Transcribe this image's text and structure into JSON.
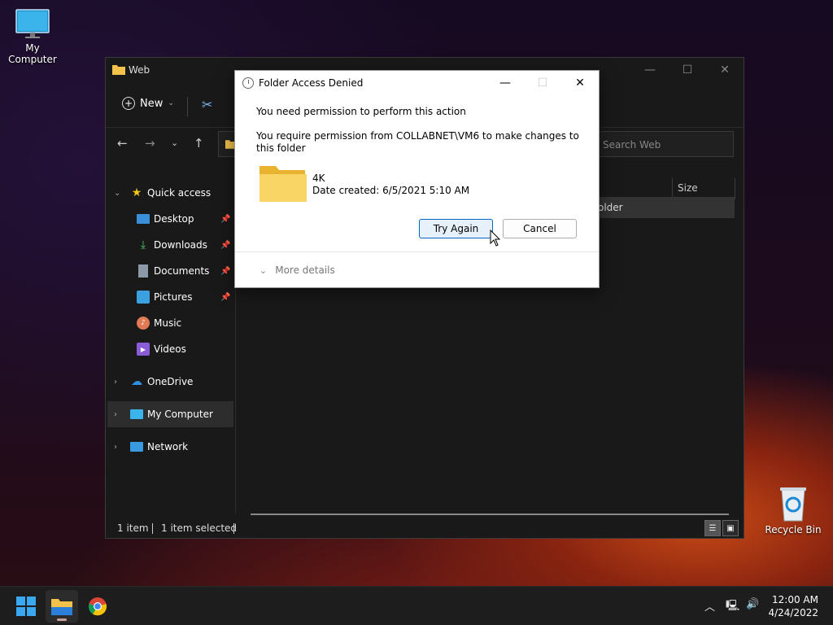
{
  "desktop": {
    "my_computer_label": "My Computer",
    "recycle_bin_label": "Recycle Bin"
  },
  "explorer": {
    "title": "Web",
    "toolbar": {
      "new_label": "New"
    },
    "search_placeholder": "Search Web",
    "column_size": "Size",
    "selected_item_partial": "older",
    "sidebar": {
      "quick_access": "Quick access",
      "items": [
        {
          "label": "Desktop",
          "icon": "desktop-icon",
          "pinned": true
        },
        {
          "label": "Downloads",
          "icon": "downloads-icon",
          "pinned": true
        },
        {
          "label": "Documents",
          "icon": "documents-icon",
          "pinned": true
        },
        {
          "label": "Pictures",
          "icon": "pictures-icon",
          "pinned": true
        },
        {
          "label": "Music",
          "icon": "music-icon",
          "pinned": false
        },
        {
          "label": "Videos",
          "icon": "videos-icon",
          "pinned": false
        }
      ],
      "onedrive": "OneDrive",
      "my_computer": "My Computer",
      "network": "Network"
    },
    "status": {
      "item_count": "1 item",
      "selected": "1 item selected"
    }
  },
  "dialog": {
    "title": "Folder Access Denied",
    "message1": "You need permission to perform this action",
    "message2": "You require permission from COLLABNET\\VM6 to make changes to this folder",
    "folder_name": "4K",
    "date_created": "Date created: 6/5/2021 5:10 AM",
    "try_again_label": "Try Again",
    "cancel_label": "Cancel",
    "more_details_label": "More details"
  },
  "taskbar": {
    "time": "12:00 AM",
    "date": "4/24/2022"
  }
}
